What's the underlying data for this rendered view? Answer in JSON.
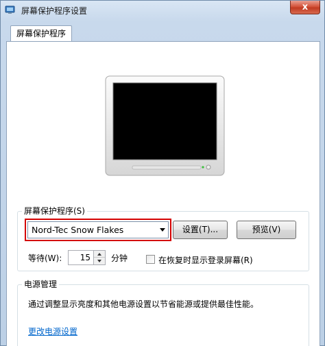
{
  "window": {
    "title": "屏幕保护程序设置",
    "close_label": "x"
  },
  "tabs": [
    {
      "label": "屏幕保护程序"
    }
  ],
  "screensaver": {
    "group_label": "屏幕保护程序(S)",
    "selected": "Nord-Tec Snow Flakes",
    "settings_button": "设置(T)...",
    "preview_button": "预览(V)",
    "wait_label": "等待(W):",
    "wait_value": "15",
    "wait_unit": "分钟",
    "resume_checkbox_label": "在恢复时显示登录屏幕(R)",
    "resume_checked": false
  },
  "power": {
    "group_label": "电源管理",
    "description": "通过调整显示亮度和其他电源设置以节省能源或提供最佳性能。",
    "link_label": "更改电源设置"
  },
  "colors": {
    "highlight": "#d40000",
    "link": "#0066cc",
    "close": "#c13b22"
  }
}
